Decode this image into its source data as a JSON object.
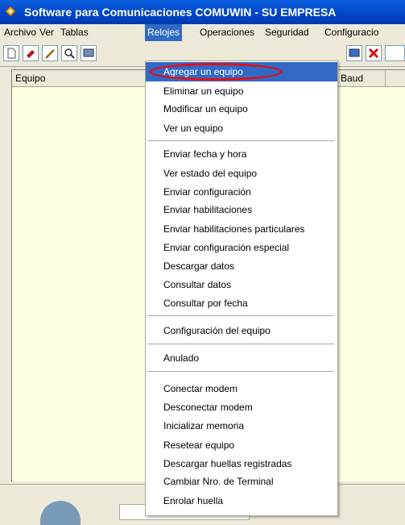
{
  "window": {
    "title": "Software para Comunicaciones COMUWIN - SU EMPRESA"
  },
  "menubar": {
    "items": [
      "Archivo",
      "Ver",
      "Tablas",
      "Relojes",
      "Operaciones",
      "Seguridad",
      "Configuracio"
    ],
    "active": "Relojes"
  },
  "toolbar": {
    "buttons": [
      "new-icon",
      "eraser-icon",
      "pencil-icon",
      "search-icon",
      "screen-icon",
      "monitor-icon",
      "delete-icon"
    ]
  },
  "grid": {
    "columns": [
      "Equipo",
      "Baud"
    ]
  },
  "menu": {
    "items": [
      "Agregar un equipo",
      "Eliminar un equipo",
      "Modificar un equipo",
      "Ver un equipo",
      "Enviar fecha y hora",
      "Ver estado del equipo",
      "Enviar configuración",
      "Enviar habilitaciones",
      "Enviar habilitaciones particulares",
      "Enviar configuración especial",
      "Descargar datos",
      "Consultar datos",
      "Consultar por fecha",
      "Configuración del equipo",
      "Anulado",
      "Conectar modem",
      "Desconectar modem",
      "Inicializar memoria",
      "Resetear equipo",
      "Descargar huellas registradas",
      "Cambiar Nro. de Terminal",
      "Enrolar huella"
    ],
    "selected": "Agregar un equipo"
  },
  "colors": {
    "titlebar": "#0246c7",
    "selection": "#316ac5",
    "panel": "#ffffe1",
    "annotation": "#e0101a"
  }
}
